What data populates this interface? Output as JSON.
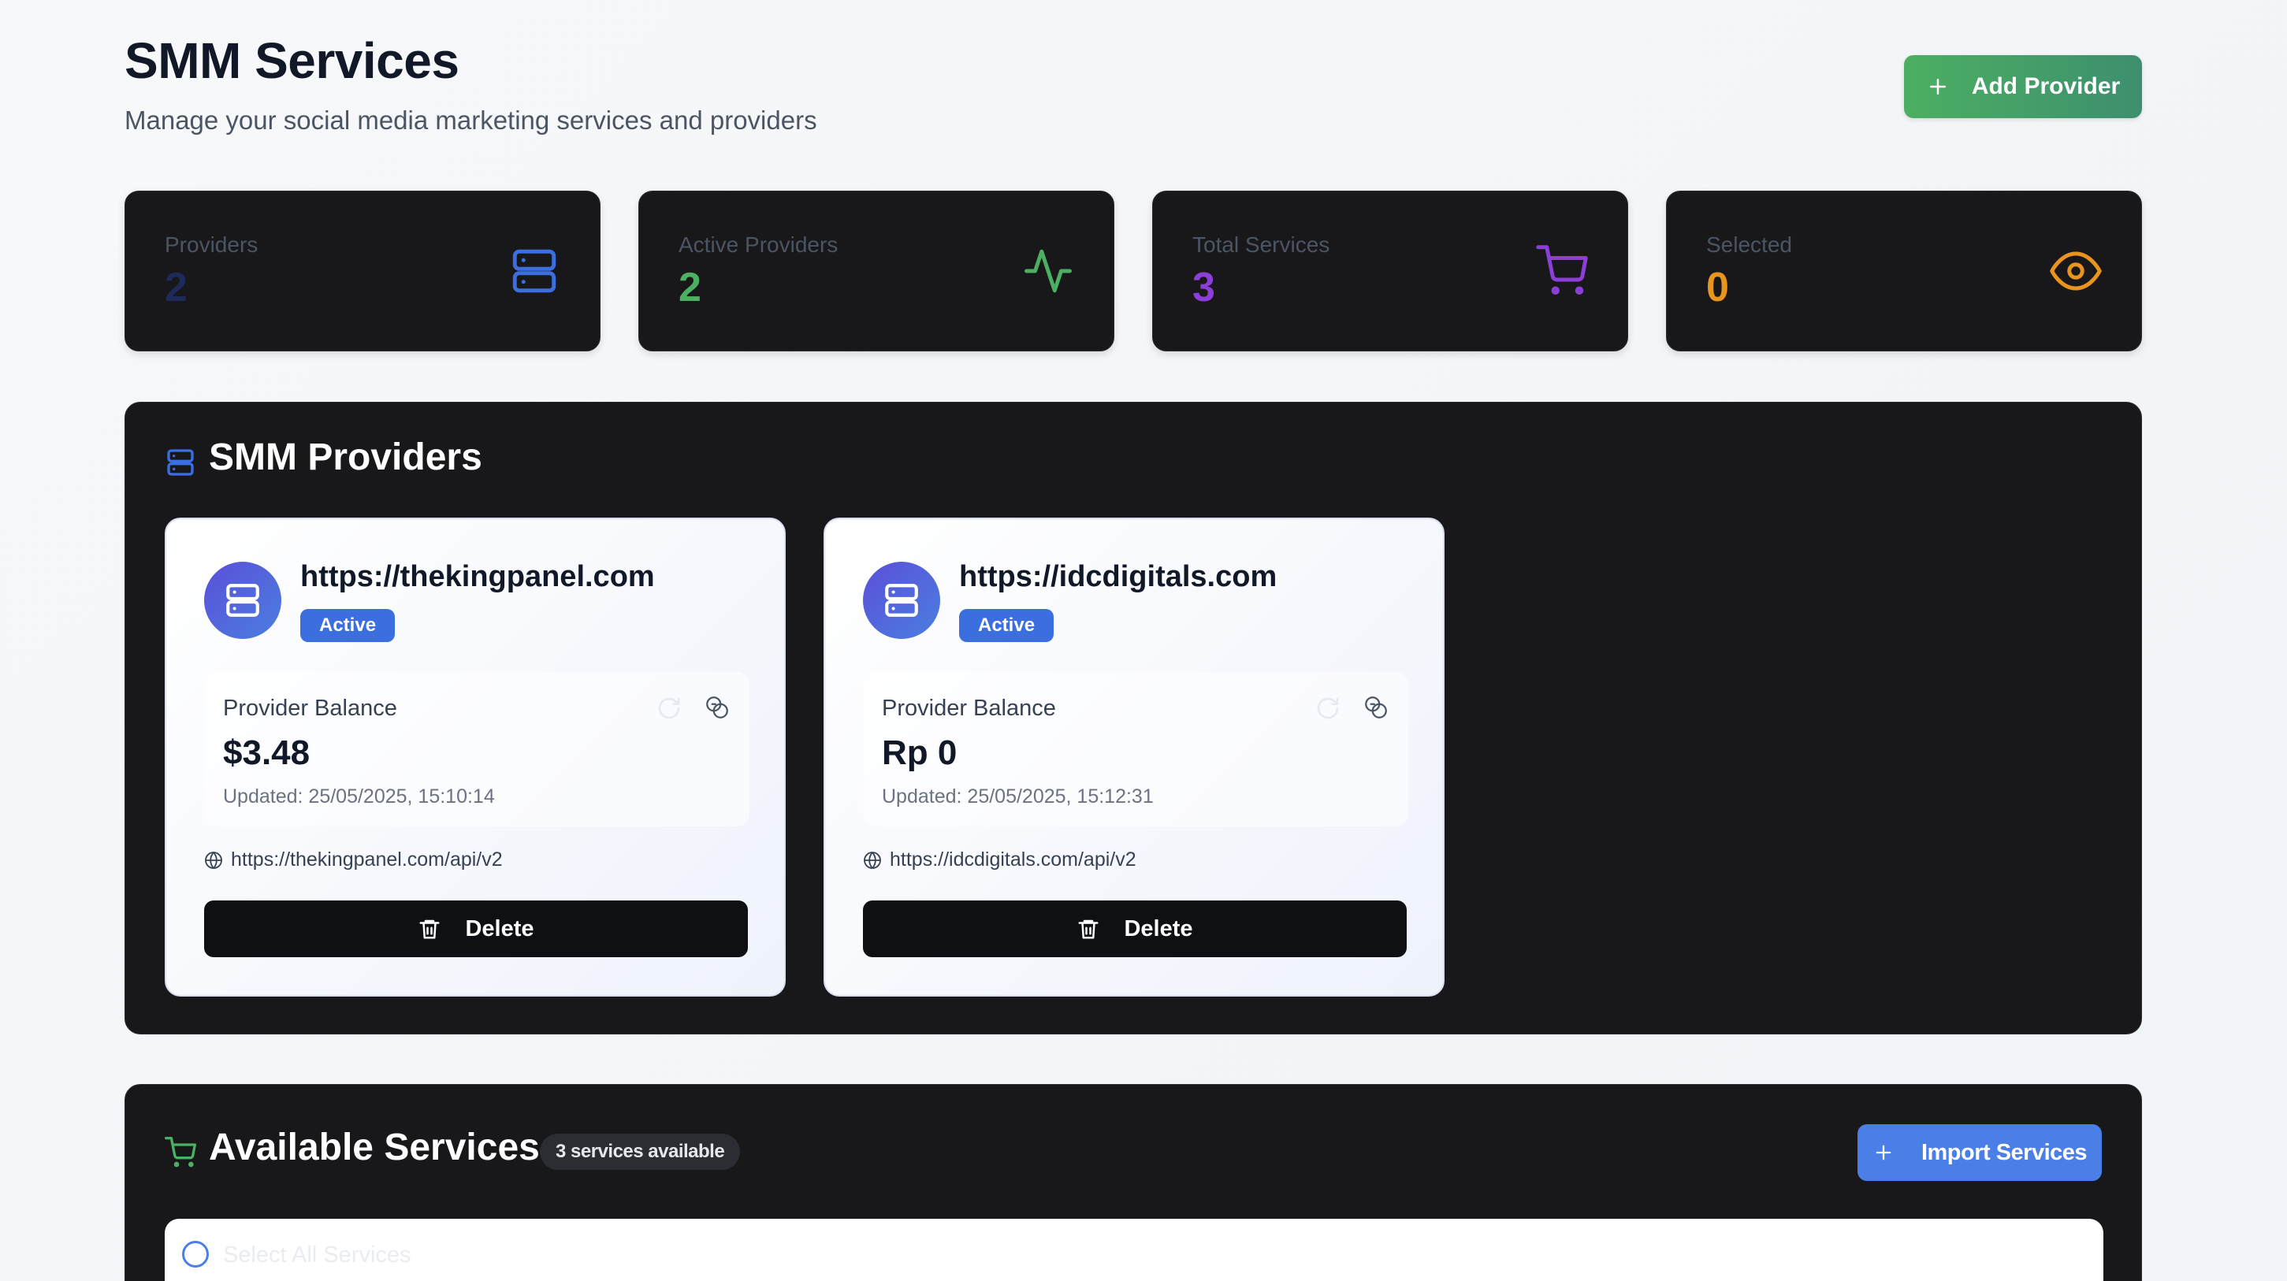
{
  "header": {
    "title": "SMM Services",
    "subtitle": "Manage your social media marketing services and providers",
    "add_provider_label": "Add Provider"
  },
  "stats": [
    {
      "label": "Providers",
      "value": "2",
      "icon": "server-icon",
      "color": "#3b6fe0",
      "value_color": "#1e2a5a"
    },
    {
      "label": "Active Providers",
      "value": "2",
      "icon": "activity-icon",
      "color": "#4caf62",
      "value_color": "#4caf62"
    },
    {
      "label": "Total Services",
      "value": "3",
      "icon": "shopping-cart-icon",
      "color": "#8b3fd6",
      "value_color": "#8b3fd6"
    },
    {
      "label": "Selected",
      "value": "0",
      "icon": "eye-icon",
      "color": "#e8941f",
      "value_color": "#e8941f"
    }
  ],
  "providers_section": {
    "title": "SMM Providers",
    "providers": [
      {
        "name": "https://thekingpanel.com",
        "status": "Active",
        "balance_label": "Provider Balance",
        "balance": "$3.48",
        "updated": "Updated: 25/05/2025, 15:10:14",
        "api_url": "https://thekingpanel.com/api/v2",
        "delete_label": "Delete"
      },
      {
        "name": "https://idcdigitals.com",
        "status": "Active",
        "balance_label": "Provider Balance",
        "balance": "Rp 0",
        "updated": "Updated: 25/05/2025, 15:12:31",
        "api_url": "https://idcdigitals.com/api/v2",
        "delete_label": "Delete"
      }
    ]
  },
  "services_section": {
    "title": "Available Services",
    "count_badge": "3 services available",
    "import_label": "Import Services",
    "select_all_label": "Select All Services"
  },
  "colors": {
    "accent_blue": "#3b6fe0",
    "accent_green": "#4caf62",
    "accent_purple": "#8b3fd6",
    "accent_orange": "#e8941f",
    "card_dark": "#18181b"
  }
}
